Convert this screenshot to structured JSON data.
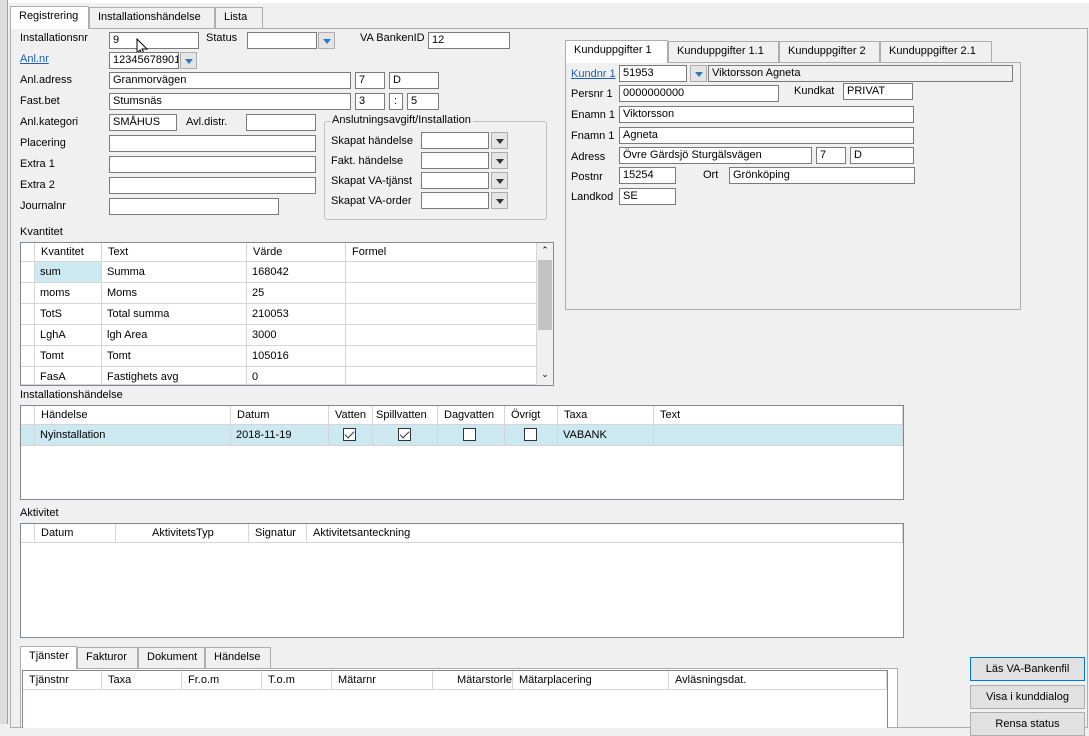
{
  "main_tabs": [
    "Registrering",
    "Installationshändelse",
    "Lista"
  ],
  "form": {
    "installationsnr_label": "Installationsnr",
    "installationsnr_value": "9",
    "status_label": "Status",
    "status_value": "",
    "va_bankenid_label": "VA BankenID",
    "va_bankenid_value": "12",
    "anlnr_label": "Anl.nr",
    "anlnr_value": "12345678901",
    "anladress_label": "Anl.adress",
    "anladress_street": "Granmorvägen",
    "anladress_number": "7",
    "anladress_letter": "D",
    "fastbet_label": "Fast.bet",
    "fastbet_name": "Stumsnäs",
    "fastbet_block": "3",
    "fastbet_sep": ":",
    "fastbet_unit": "5",
    "anlkategori_label": "Anl.kategori",
    "anlkategori_value": "SMÅHUS",
    "avldistr_label": "Avl.distr.",
    "avldistr_value": "",
    "placering_label": "Placering",
    "extra1_label": "Extra 1",
    "extra2_label": "Extra 2",
    "journalnr_label": "Journalnr"
  },
  "anslutning": {
    "title": "Anslutningsavgift/Installation",
    "rows": [
      "Skapat händelse",
      "Fakt. händelse",
      "Skapat VA-tjänst",
      "Skapat VA-order"
    ]
  },
  "kund_tabs": [
    "Kunduppgifter 1",
    "Kunduppgifter 1.1",
    "Kunduppgifter 2",
    "Kunduppgifter 2.1"
  ],
  "kund": {
    "kundnr_label": "Kundnr 1",
    "kundnr_value": "51953",
    "kundnamn_value": "Viktorsson Agneta",
    "persnr_label": "Persnr 1",
    "persnr_value": "0000000000",
    "kundkat_label": "Kundkat",
    "kundkat_value": "PRIVAT",
    "enamn_label": "Enamn 1",
    "enamn_value": "Viktorsson",
    "fnamn_label": "Fnamn 1",
    "fnamn_value": "Agneta",
    "adress_label": "Adress",
    "adress_street": "Övre Gärdsjö Sturgälsvägen",
    "adress_number": "7",
    "adress_letter": "D",
    "postnr_label": "Postnr",
    "postnr_value": "15254",
    "ort_label": "Ort",
    "ort_value": "Grönköping",
    "landkod_label": "Landkod",
    "landkod_value": "SE"
  },
  "kvantitet": {
    "title": "Kvantitet",
    "columns": [
      "Kvantitet",
      "Text",
      "Värde",
      "Formel"
    ],
    "rows": [
      [
        "sum",
        "Summa",
        "168042",
        ""
      ],
      [
        "moms",
        "Moms",
        "25",
        ""
      ],
      [
        "TotS",
        "Total summa",
        "210053",
        ""
      ],
      [
        "LghA",
        "lgh Area",
        "3000",
        ""
      ],
      [
        "Tomt",
        "Tomt",
        "105016",
        ""
      ],
      [
        "FasA",
        "Fastighets avg",
        "0",
        ""
      ]
    ]
  },
  "installationshandelse": {
    "title": "Installationshändelse",
    "columns": [
      "Händelse",
      "Datum",
      "Vatten",
      "Spillvatten",
      "Dagvatten",
      "Övrigt",
      "Taxa",
      "Text"
    ],
    "rows": [
      {
        "handelse": "Nyinstallation",
        "datum": "2018-11-19",
        "vatten": true,
        "spillvatten": true,
        "dagvatten": false,
        "ovrigt": false,
        "taxa": "VABANK",
        "text": ""
      }
    ]
  },
  "aktivitet": {
    "title": "Aktivitet",
    "columns": [
      "Datum",
      "AktivitetsTyp",
      "Signatur",
      "Aktivitetsanteckning"
    ]
  },
  "bottom_tabs": [
    "Tjänster",
    "Fakturor",
    "Dokument",
    "Händelse"
  ],
  "tjanster": {
    "columns": [
      "Tjänstnr",
      "Taxa",
      "Fr.o.m",
      "T.o.m",
      "Mätarnr",
      "Mätarstorlek",
      "Mätarplacering",
      "Avläsningsdat."
    ]
  },
  "buttons": {
    "las_va": "Läs VA-Bankenfil",
    "visa_kund": "Visa i kunddialog",
    "rensa_status": "Rensa status"
  },
  "colors": {
    "selected_row": "#cce8f1",
    "link": "#1a5fb4",
    "accent_border": "#0078d7"
  }
}
